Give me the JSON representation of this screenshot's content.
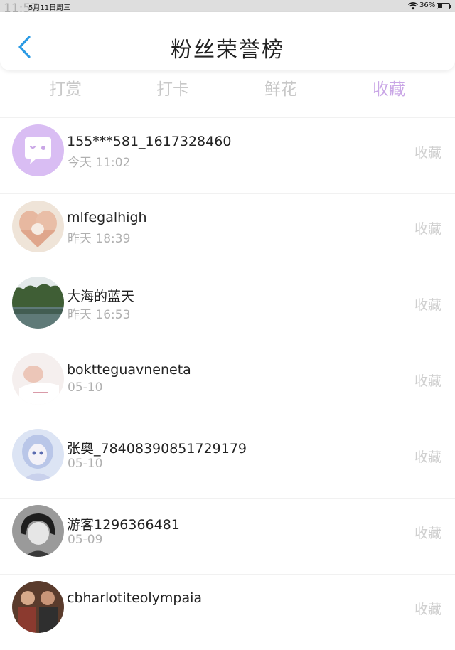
{
  "status_bar": {
    "time": "11:57",
    "date": "5月11日周三",
    "battery": "36%",
    "battery_level": 0.36
  },
  "header": {
    "title": "粉丝荣誉榜"
  },
  "tabs": [
    {
      "label": "打赏",
      "active": false
    },
    {
      "label": "打卡",
      "active": false
    },
    {
      "label": "鲜花",
      "active": false
    },
    {
      "label": "收藏",
      "active": true
    }
  ],
  "fans": [
    {
      "name": "155***581_1617328460",
      "time": "今天 11:02",
      "tag": "收藏",
      "avatar": "default-chat-avatar"
    },
    {
      "name": "mlfegalhigh",
      "time": "昨天 18:39",
      "tag": "收藏",
      "avatar": "hands-heart-photo"
    },
    {
      "name": "大海的蓝天",
      "time": "昨天 16:53",
      "tag": "收藏",
      "avatar": "lake-landscape-photo"
    },
    {
      "name": "boktteguavneneta",
      "time": "05-10",
      "tag": "收藏",
      "avatar": "sleeping-baby-photo"
    },
    {
      "name": "张奥_78408390851729179",
      "time": "05-10",
      "tag": "收藏",
      "avatar": "anime-girl-photo"
    },
    {
      "name": "游客1296366481",
      "time": "05-09",
      "tag": "收藏",
      "avatar": "black-white-portrait-photo"
    },
    {
      "name": "cbharlotiteolympaia",
      "time": "",
      "tag": "收藏",
      "avatar": "group-photo"
    }
  ],
  "colors": {
    "accent": "#c9a6e6",
    "back_arrow": "#2a9ae4",
    "muted": "#b0b0b0"
  }
}
